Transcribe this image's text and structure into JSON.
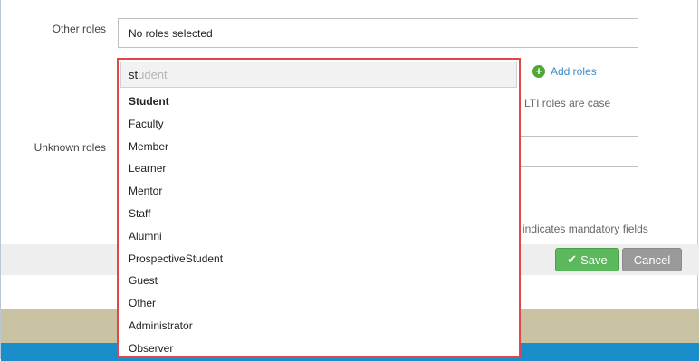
{
  "form": {
    "other_roles_label": "Other roles",
    "other_roles_value": "No roles selected",
    "unknown_roles_label": "Unknown roles",
    "unknown_roles_value": "",
    "add_roles_label": "Add roles",
    "case_note": "LTI roles are case",
    "mandatory_note": "indicates mandatory fields"
  },
  "dropdown": {
    "typed": "st",
    "suggestion_rest": "udent",
    "options": [
      "Student",
      "Faculty",
      "Member",
      "Learner",
      "Mentor",
      "Staff",
      "Alumni",
      "ProspectiveStudent",
      "Guest",
      "Other",
      "Administrator",
      "Observer"
    ]
  },
  "buttons": {
    "save_label": "Save",
    "cancel_label": "Cancel"
  },
  "icons": {
    "add": "plus-circle-icon",
    "save": "checkmark-icon"
  },
  "colors": {
    "highlight_border": "#e0474c",
    "save_button": "#5cb85c",
    "cancel_button": "#9a9a9a",
    "add_icon": "#4ea836",
    "link": "#3a8acb",
    "footer_blue": "#1a8dcb",
    "brand_band": "#c9c3a4"
  }
}
